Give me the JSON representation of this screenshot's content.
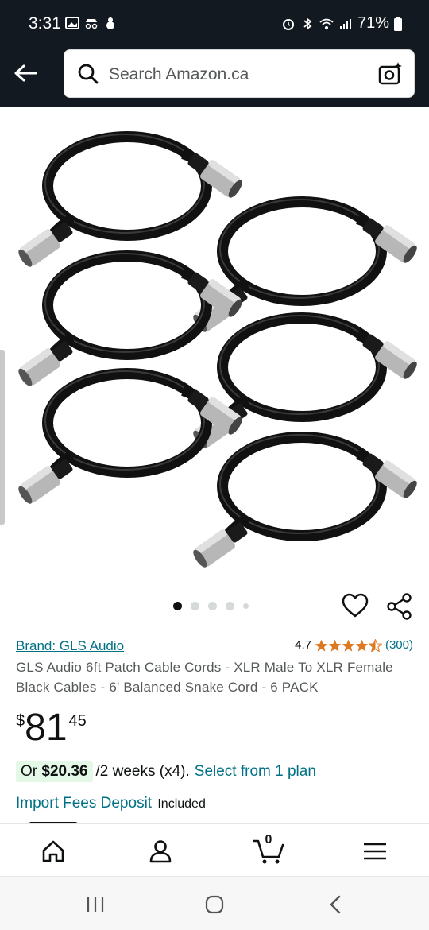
{
  "status_bar": {
    "time": "3:31",
    "battery": "71%"
  },
  "search": {
    "placeholder": "Search Amazon.ca"
  },
  "carousel": {
    "dots": 5,
    "active_index": 0
  },
  "product": {
    "brand": "Brand: GLS Audio",
    "rating": "4.7",
    "stars": 4.5,
    "rating_count": "(300)",
    "title": "GLS Audio 6ft Patch Cable Cords - XLR Male To XLR Female Black Cables - 6' Balanced Snake Cord - 6 PACK",
    "price": {
      "symbol": "$",
      "whole": "81",
      "fraction": "45"
    },
    "installment": {
      "or_label": "Or",
      "amount": "$20.36",
      "terms": "/2 weeks (x4).",
      "select": "Select from 1 plan"
    },
    "import_fees": {
      "link": "Import Fees Deposit",
      "status": "Included"
    }
  },
  "bottom_nav": {
    "cart_count": "0"
  },
  "colors": {
    "header_bg": "#131921",
    "link": "#007185",
    "star": "#de7921",
    "badge_bg": "#e3f8e7"
  }
}
